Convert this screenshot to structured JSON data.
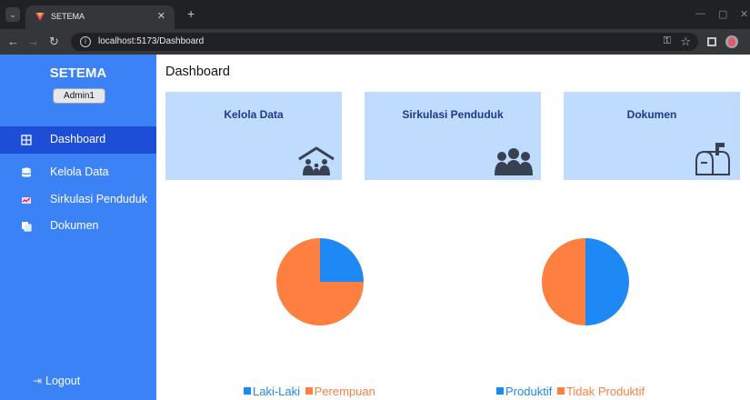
{
  "browser": {
    "tab_title": "SETEMA",
    "url": "localhost:5173/Dashboard"
  },
  "sidebar": {
    "brand": "SETEMA",
    "user": "Admin1",
    "items": [
      {
        "label": "Dashboard",
        "icon": "table-grid-icon",
        "active": true
      },
      {
        "label": "Kelola Data",
        "icon": "database-icon",
        "active": false
      },
      {
        "label": "Sirkulasi Penduduk",
        "icon": "chart-icon",
        "active": false
      },
      {
        "label": "Dokumen",
        "icon": "document-stack-icon",
        "active": false
      }
    ],
    "logout": "Logout"
  },
  "main": {
    "title": "Dashboard",
    "cards": [
      {
        "title": "Kelola Data",
        "icon": "family-house-icon"
      },
      {
        "title": "Sirkulasi Penduduk",
        "icon": "people-group-icon"
      },
      {
        "title": "Dokumen",
        "icon": "mailbox-icon"
      }
    ]
  },
  "colors": {
    "sidebar": "#3b82f6",
    "sidebar_active": "#1d4ed8",
    "card": "#bfdbfe",
    "series_blue": "#1e88f5",
    "series_orange": "#ff7f41"
  },
  "chart_data": [
    {
      "type": "pie",
      "categories": [
        "Laki-Laki",
        "Perempuan"
      ],
      "values": [
        25,
        75
      ],
      "colors": [
        "#1e88f5",
        "#ff7f41"
      ],
      "legend": "bottom"
    },
    {
      "type": "pie",
      "categories": [
        "Produktif",
        "Tidak Produktif"
      ],
      "values": [
        50,
        50
      ],
      "colors": [
        "#1e88f5",
        "#ff7f41"
      ],
      "legend": "bottom"
    }
  ]
}
